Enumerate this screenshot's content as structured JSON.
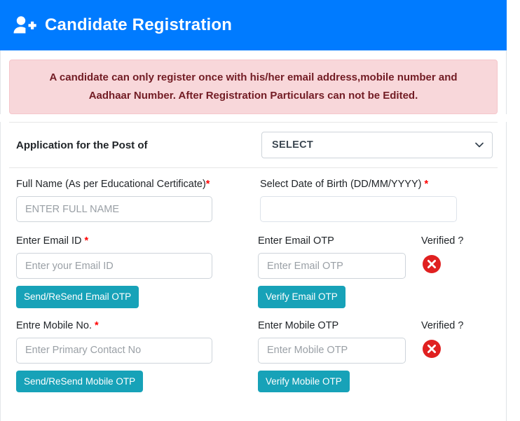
{
  "header": {
    "icon": "user-plus-icon",
    "title": "Candidate Registration",
    "background_color": "#007bff"
  },
  "alert": {
    "line1": "A candidate can only register once with his/her email address,mobile number and",
    "line2": "Aadhaar Number. After Registration Particulars can not be Edited.",
    "background_color": "#f8d7da",
    "text_color": "#721c24"
  },
  "post": {
    "label": "Application for the Post of",
    "select_value": "SELECT",
    "select_icon": "chevron-down-icon"
  },
  "fields": {
    "full_name": {
      "label": "Full Name (As per Educational Certificate)",
      "required_mark": "*",
      "placeholder": "ENTER FULL NAME",
      "value": ""
    },
    "dob": {
      "label": "Select Date of Birth (DD/MM/YYYY)",
      "required_mark": "*",
      "placeholder": "",
      "value": ""
    },
    "email": {
      "label": "Enter Email ID",
      "required_mark": "*",
      "placeholder": "Enter your Email ID",
      "value": "",
      "send_button": "Send/ReSend Email OTP"
    },
    "email_otp": {
      "label": "Enter Email OTP",
      "placeholder": "Enter Email OTP",
      "value": "",
      "verify_button": "Verify Email OTP"
    },
    "email_verified": {
      "label": "Verified ?",
      "status_icon": "circle-x-icon",
      "status": "not-verified",
      "color": "#e02020"
    },
    "mobile": {
      "label": "Entre Mobile No.",
      "required_mark": "*",
      "placeholder": "Enter Primary Contact No",
      "value": "",
      "send_button": "Send/ReSend Mobile OTP"
    },
    "mobile_otp": {
      "label": "Enter Mobile OTP",
      "placeholder": "Enter Mobile OTP",
      "value": "",
      "verify_button": "Verify Mobile OTP"
    },
    "mobile_verified": {
      "label": "Verified ?",
      "status_icon": "circle-x-icon",
      "status": "not-verified",
      "color": "#e02020"
    }
  },
  "colors": {
    "primary": "#007bff",
    "button_teal": "#17a2b8",
    "danger": "#e02020",
    "border": "#ced4da"
  }
}
